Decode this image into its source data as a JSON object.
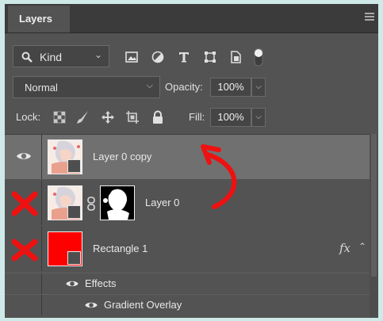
{
  "panel": {
    "tab_label": "Layers"
  },
  "filter": {
    "kind_label": "Kind",
    "icons": [
      "image-filter-icon",
      "adjustment-filter-icon",
      "type-filter-icon",
      "shape-filter-icon",
      "smart-object-filter-icon",
      "filter-toggle-icon"
    ]
  },
  "blend": {
    "mode": "Normal",
    "opacity_label": "Opacity:",
    "opacity_value": "100%"
  },
  "lock": {
    "label": "Lock:",
    "fill_label": "Fill:",
    "fill_value": "100%"
  },
  "layers": [
    {
      "name": "Layer 0 copy",
      "visible": true,
      "selected": true,
      "thumb_color": "#f3dcd4"
    },
    {
      "name": "Layer 0",
      "visible": false,
      "has_mask": true,
      "thumb_color": "#f3dcd4"
    },
    {
      "name": "Rectangle 1",
      "visible": false,
      "fx_label": "fx",
      "thumb_color": "#ff0000",
      "effects_label": "Effects",
      "effect_items": [
        "Gradient Overlay"
      ]
    }
  ],
  "colors": {
    "panel_bg": "#535353",
    "selected_row": "#707070",
    "annotation_red": "#ee1111"
  }
}
